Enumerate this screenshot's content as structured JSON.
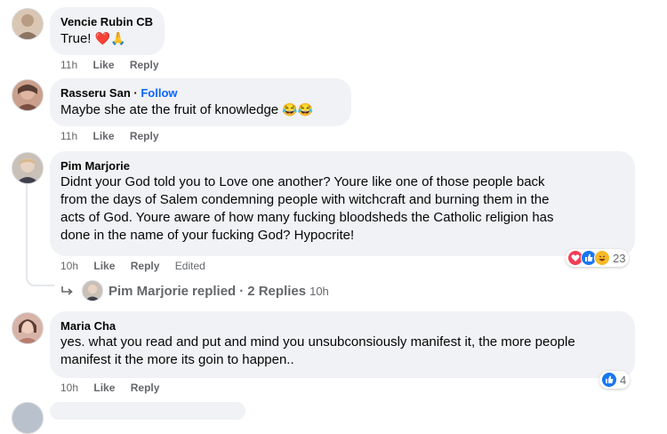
{
  "comments": [
    {
      "name": "Vencie Rubin CB",
      "text": "True!",
      "emoji": "❤️🙏",
      "time": "11h",
      "like": "Like",
      "reply": "Reply"
    },
    {
      "name": "Rasseru San",
      "dot": "·",
      "follow": "Follow",
      "text": "Maybe she ate the fruit of knowledge",
      "emoji": "😂😂",
      "time": "11h",
      "like": "Like",
      "reply": "Reply"
    },
    {
      "name": "Pim Marjorie",
      "lines": [
        "Didnt your God told you to Love one another? Youre like one of those people back",
        "from the days of Salem condemning people with witchcraft and burning them in the",
        "acts of God. Youre aware of how many fucking bloodsheds the Catholic religion has",
        "done in the name of your fucking God? Hypocrite!"
      ],
      "time": "10h",
      "like": "Like",
      "reply": "Reply",
      "edited": "Edited",
      "reaction_count": "23",
      "replies_summary": {
        "name": "Pim Marjorie",
        "action": "replied",
        "dot": "·",
        "count": "2 Replies",
        "time": "10h"
      }
    },
    {
      "name": "Maria Cha",
      "lines": [
        "yes. what you read and put and mind you unsubconsiously manifest it, the more people",
        "manifest it the more its goin to happen.."
      ],
      "time": "10h",
      "like": "Like",
      "reply": "Reply",
      "reaction_count": "4"
    }
  ],
  "colors": {
    "bubble": "#f0f2f5",
    "meta": "#65676b",
    "like_blue": "#1877f2",
    "love_red": "#f33e58",
    "haha_yellow": "#f7b928",
    "follow_blue": "#0866ff"
  }
}
